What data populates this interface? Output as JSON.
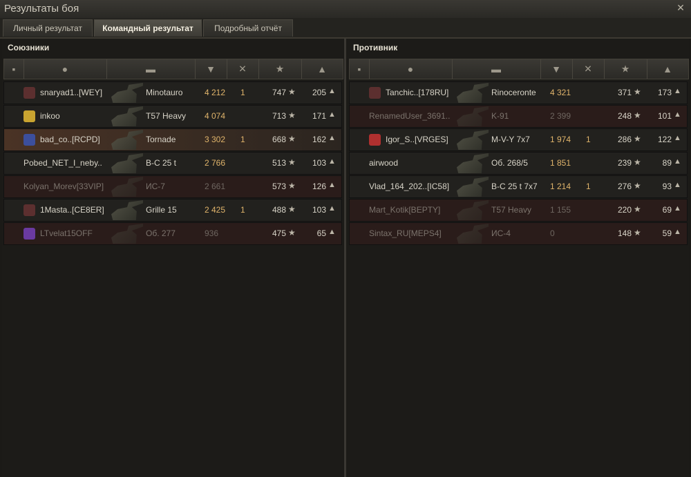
{
  "window": {
    "title": "Результаты боя",
    "close_icon": "close-icon"
  },
  "tabs": [
    {
      "label": "Личный результат",
      "active": false
    },
    {
      "label": "Командный результат",
      "active": true
    },
    {
      "label": "Подробный отчёт",
      "active": false
    }
  ],
  "teams": {
    "allies": {
      "label": "Союзники",
      "rows": [
        {
          "player": "snaryad1..[WEY]",
          "tank": "Minotauro",
          "damage": "4 212",
          "kills": "1",
          "xp": "747",
          "credits": "205",
          "state": "alive"
        },
        {
          "player": "inkoo",
          "tank": "T57 Heavy",
          "damage": "4 074",
          "kills": "",
          "xp": "713",
          "credits": "171",
          "state": "alive"
        },
        {
          "player": "bad_co..[RCPD]",
          "tank": "Tornade",
          "damage": "3 302",
          "kills": "1",
          "xp": "668",
          "credits": "162",
          "state": "self"
        },
        {
          "player": "Pobed_NET_I_neby..",
          "tank": "B-C 25 t",
          "damage": "2 766",
          "kills": "",
          "xp": "513",
          "credits": "103",
          "state": "alive"
        },
        {
          "player": "Kolyan_Morev[33VIP]",
          "tank": "ИС-7",
          "damage": "2 661",
          "kills": "",
          "xp": "573",
          "credits": "126",
          "state": "dead"
        },
        {
          "player": "1Masta..[CE8ER]",
          "tank": "Grille 15",
          "damage": "2 425",
          "kills": "1",
          "xp": "488",
          "credits": "103",
          "state": "alive"
        },
        {
          "player": "LTvelat15OFF",
          "tank": "Об. 277",
          "damage": "936",
          "kills": "",
          "xp": "475",
          "credits": "65",
          "state": "dead"
        }
      ]
    },
    "enemies": {
      "label": "Противник",
      "rows": [
        {
          "player": "Tanchic..[178RU]",
          "tank": "Rinoceronte",
          "damage": "4 321",
          "kills": "",
          "xp": "371",
          "credits": "173",
          "state": "alive"
        },
        {
          "player": "RenamedUser_3691..",
          "tank": "K-91",
          "damage": "2 399",
          "kills": "",
          "xp": "248",
          "credits": "101",
          "state": "dead"
        },
        {
          "player": "Igor_S..[VRGES]",
          "tank": "M-V-Y 7x7",
          "damage": "1 974",
          "kills": "1",
          "xp": "286",
          "credits": "122",
          "state": "alive"
        },
        {
          "player": "airwood",
          "tank": "Об. 268/5",
          "damage": "1 851",
          "kills": "",
          "xp": "239",
          "credits": "89",
          "state": "alive"
        },
        {
          "player": "Vlad_164_202..[IC58]",
          "tank": "B-C 25 t 7x7",
          "damage": "1 214",
          "kills": "1",
          "xp": "276",
          "credits": "93",
          "state": "alive"
        },
        {
          "player": "Mart_Kotik[BEPTY]",
          "tank": "T57 Heavy",
          "damage": "1 155",
          "kills": "",
          "xp": "220",
          "credits": "69",
          "state": "dead"
        },
        {
          "player": "Sintax_RU[MEPS4]",
          "tank": "ИС-4",
          "damage": "0",
          "kills": "",
          "xp": "148",
          "credits": "59",
          "state": "dead"
        }
      ]
    }
  },
  "header_icons": [
    "platoon-icon",
    "player-icon",
    "tank-icon",
    "damage-icon",
    "kills-icon",
    "xp-star-icon",
    "credits-icon"
  ],
  "colors": {
    "damage": "#e0b46b",
    "dead_row": "#2a1c1a",
    "self_row": "#4a3325"
  }
}
